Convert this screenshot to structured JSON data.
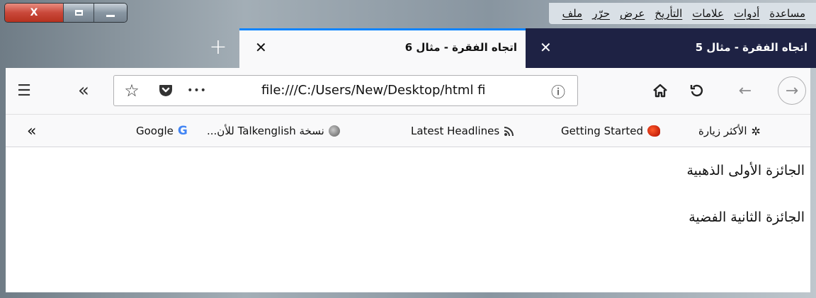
{
  "menubar": {
    "items": [
      "ملف",
      "حرّر",
      "عرض",
      "التأريخ",
      "علامات",
      "أدوات",
      "مساعدة"
    ]
  },
  "window_controls": {
    "close_label": "X"
  },
  "tabs": [
    {
      "label": "اتجاه الفقرة - مثال 6",
      "active": true
    },
    {
      "label": "اتجاه الفقرة - مثال 5",
      "active": false
    }
  ],
  "tab_close_glyph": "✕",
  "new_tab_glyph": "+",
  "toolbar": {
    "menu_glyph": "☰",
    "overflow_glyph": "«",
    "url": "file:///C:/Users/New/Desktop/html fi",
    "star_glyph": "☆",
    "more_glyph": "•••",
    "info_glyph": "ⓘ",
    "home_glyph": "⌂",
    "reload_glyph": "↺",
    "back_glyph": "←",
    "forward_glyph": "→"
  },
  "bookmarks": {
    "overflow_glyph": "«",
    "items": [
      {
        "label": "الأكثر زيارة",
        "icon": "gear-icon"
      },
      {
        "label": "Getting Started",
        "icon": "firefox-icon"
      },
      {
        "label": "Latest Headlines",
        "icon": "rss-icon"
      },
      {
        "label": "نسخة Talkenglish للأن...",
        "icon": "globe-icon"
      },
      {
        "label": "Google",
        "icon": "google-icon"
      }
    ],
    "google_letter": "G",
    "gear_glyph": "✲",
    "rss_glyph": "))"
  },
  "content": {
    "paragraphs": [
      "الجائزة الأولى الذهبية",
      "الجائزة الثانية الفضية"
    ]
  }
}
